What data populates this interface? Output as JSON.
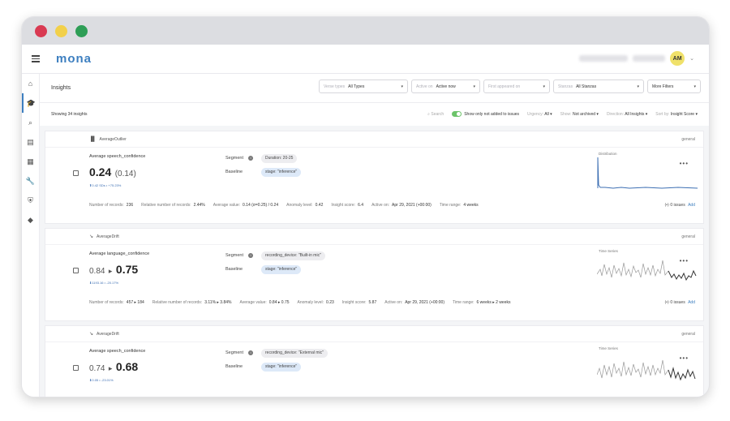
{
  "app": {
    "logo": "mona",
    "avatar_initials": "AM"
  },
  "header": {
    "title": "Insights",
    "filters": [
      {
        "label": "Verse types",
        "value": "All Types"
      },
      {
        "label": "Active on",
        "value": "Active now"
      },
      {
        "label": "First appeared on",
        "value": ""
      },
      {
        "label": "Stanzas",
        "value": "All Stanzas"
      },
      {
        "label": "",
        "value": "More Filters"
      }
    ]
  },
  "subbar": {
    "showing": "Showing 34 insights",
    "search": "Search",
    "toggle_label": "Show only not added to issues",
    "urgency_label": "Urgency:",
    "urgency_value": "All",
    "show_label": "Show:",
    "show_value": "Not archived",
    "direction_label": "Direction:",
    "direction_value": "All Insights",
    "sort_label": "Sort by:",
    "sort_value": "Insight Score"
  },
  "labels": {
    "segment": "Segment",
    "baseline": "Baseline",
    "issues": "0 issues",
    "add": "Add"
  },
  "cards": [
    {
      "type": "AverageOutlier",
      "tag": "general",
      "metric": "Average speech_confidence",
      "value_main": "0.24",
      "value_sub": "(0.14)",
      "change": "⬆0.42 SDs • +75.23%",
      "segment": "Duration: 20-25",
      "baseline": "stage: \"inference\"",
      "chart_label": "Distribution",
      "footer": [
        {
          "k": "Number of records:",
          "v": "236"
        },
        {
          "k": "Relative number of records:",
          "v": "2.44%"
        },
        {
          "k": "Average value:",
          "v": "0.14 (σ=0.25) / 0.24"
        },
        {
          "k": "Anomaly level:",
          "v": "0.42"
        },
        {
          "k": "Insight score:",
          "v": "6.4"
        },
        {
          "k": "Active on:",
          "v": "Apr 29, 2021 (+00:00)"
        },
        {
          "k": "Time range:",
          "v": "4 weeks"
        }
      ]
    },
    {
      "type": "AverageDrift",
      "tag": "general",
      "metric": "Average language_confidence",
      "value_from": "0.84",
      "value_to": "0.75",
      "change": "⬇1193.16 • -20.17%",
      "segment": "recording_device: \"Built-in mic\"",
      "baseline": "stage: \"inference\"",
      "chart_label": "Time Series",
      "footer": [
        {
          "k": "Number of records:",
          "v": "457 ▸ 184"
        },
        {
          "k": "Relative number of records:",
          "v": "3.11% ▸ 3.84%"
        },
        {
          "k": "Average value:",
          "v": "0.84 ▸ 0.75"
        },
        {
          "k": "Anomaly level:",
          "v": "0.23"
        },
        {
          "k": "Insight score:",
          "v": "5.87"
        },
        {
          "k": "Active on:",
          "v": "Apr 29, 2021 (+00:00)"
        },
        {
          "k": "Time range:",
          "v": "6 weeks ▸ 2 weeks"
        }
      ]
    },
    {
      "type": "AverageDrift",
      "tag": "general",
      "metric": "Average speech_confidence",
      "value_from": "0.74",
      "value_to": "0.68",
      "change": "⬇0.05 • -23.01%",
      "segment": "recording_device: \"External mic\"",
      "baseline": "stage: \"inference\"",
      "chart_label": "Time Series"
    }
  ]
}
